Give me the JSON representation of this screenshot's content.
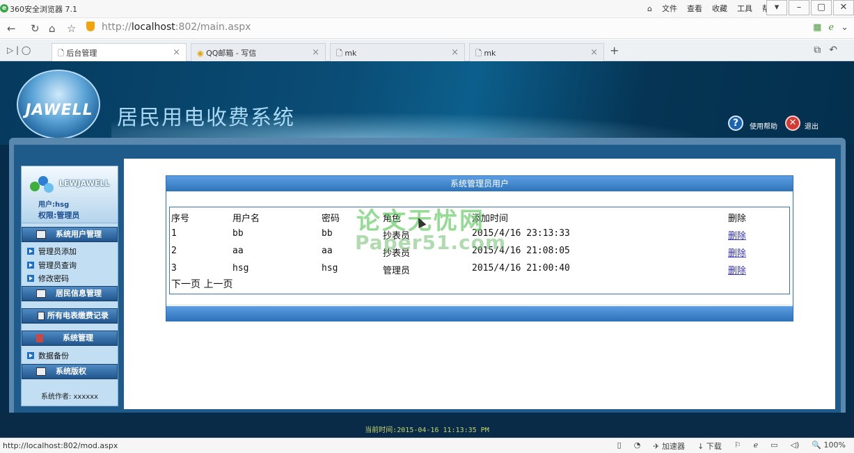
{
  "browser": {
    "title": "360安全浏览器 7.1",
    "menu": [
      "文件",
      "查看",
      "收藏",
      "工具",
      "帮助"
    ],
    "url_prefix": "http://",
    "url_host": "localhost",
    "url_rest": ":802/main.aspx",
    "tabs": [
      {
        "label": "后台管理",
        "active": true
      },
      {
        "label": "QQ邮箱 - 写信",
        "active": false
      },
      {
        "label": "mk",
        "active": false
      },
      {
        "label": "mk",
        "active": false
      }
    ],
    "status_url": "http://localhost:802/mod.aspx",
    "status_items": [
      "加速器",
      "下载",
      "100%"
    ]
  },
  "header": {
    "logo_text": "JAWELL",
    "system_title": "居民用电收费系统",
    "help_label": "使用帮助",
    "exit_label": "退出"
  },
  "sidebar": {
    "user_banner": "LEWJAWELL",
    "user_line": "用户:hsg",
    "role_line": "权限:管理员",
    "sections": [
      {
        "label": "系统用户管理",
        "items": [
          "管理员添加",
          "管理员查询",
          "修改密码"
        ]
      },
      {
        "label": "居民信息管理",
        "items": []
      },
      {
        "label": "所有电表缴费记录",
        "items": []
      },
      {
        "label": "系统管理",
        "items": [
          "数据备份"
        ]
      },
      {
        "label": "系统版权",
        "items": []
      }
    ],
    "author": "系统作者: xxxxxx"
  },
  "main": {
    "panel_title": "系统管理员用户",
    "columns": [
      "序号",
      "用户名",
      "密码",
      "角色",
      "添加时间",
      "删除"
    ],
    "rows": [
      [
        "1",
        "bb",
        "bb",
        "抄表员",
        "2015/4/16 23:13:33",
        "删除"
      ],
      [
        "2",
        "aa",
        "aa",
        "抄表员",
        "2015/4/16 21:08:05",
        "删除"
      ],
      [
        "3",
        "hsg",
        "hsg",
        "管理员",
        "2015/4/16 21:00:40",
        "删除"
      ]
    ],
    "pager_next": "下一页",
    "pager_prev": "上一页"
  },
  "watermark": {
    "line1": "论文无忧网",
    "line2": "Paper51.com"
  },
  "footer": {
    "clock": "当前时间:2015-04-16 11:13:35 PM"
  }
}
